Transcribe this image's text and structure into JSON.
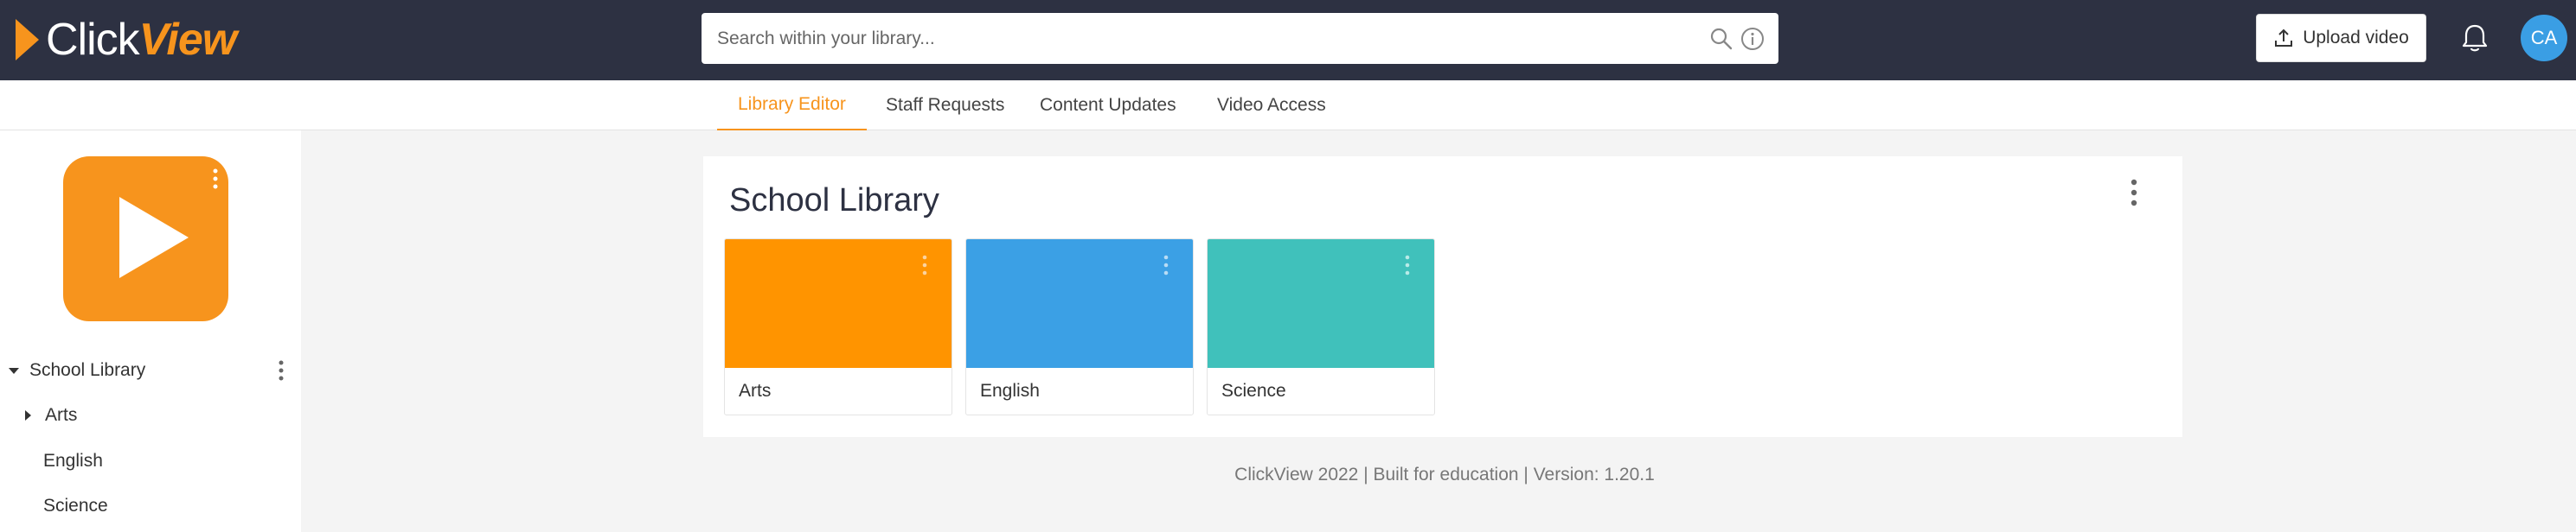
{
  "brand": {
    "logo_click": "Click",
    "logo_view": "View"
  },
  "search": {
    "placeholder": "Search within your library..."
  },
  "header": {
    "upload_label": "Upload video",
    "avatar_initials": "CA"
  },
  "tabs": [
    {
      "label": "Library Editor",
      "active": true
    },
    {
      "label": "Staff Requests",
      "active": false
    },
    {
      "label": "Content Updates",
      "active": false
    },
    {
      "label": "Video Access",
      "active": false
    }
  ],
  "sidebar": {
    "root": "School Library",
    "items": [
      {
        "label": "Arts",
        "expandable": true
      },
      {
        "label": "English",
        "expandable": false
      },
      {
        "label": "Science",
        "expandable": false
      }
    ]
  },
  "main": {
    "title": "School Library",
    "cards": [
      {
        "label": "Arts",
        "color": "#ff9400"
      },
      {
        "label": "English",
        "color": "#3ba0e5"
      },
      {
        "label": "Science",
        "color": "#40c1bb"
      }
    ]
  },
  "footer": {
    "text": "ClickView 2022 | Built for education | Version: 1.20.1"
  },
  "colors": {
    "topbar": "#2d3142",
    "accent": "#f7941d",
    "avatar": "#3a9ee4"
  }
}
